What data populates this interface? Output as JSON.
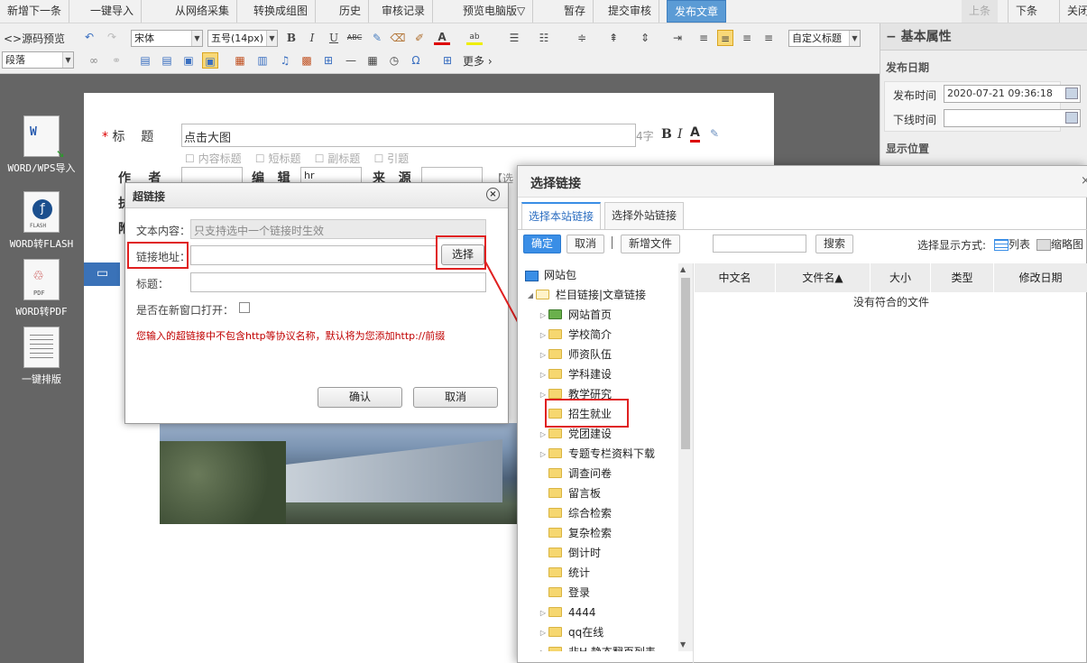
{
  "topbar": {
    "items": [
      "新增下一条",
      "一键导入",
      "从网络采集",
      "转换成组图",
      "历史",
      "审核记录",
      "预览电脑版▽",
      "暂存",
      "提交审核",
      "发布文章"
    ],
    "right_items": [
      "上条",
      "下条",
      "关闭"
    ]
  },
  "editor_toolbar": {
    "source": "<>源码",
    "preview": "预览",
    "font": "宋体",
    "size": "五号(14px)",
    "custom_title": "自定义标题",
    "paragraph": "段落",
    "more": "更多"
  },
  "right_panel": {
    "title": "基本属性",
    "publish_date_heading": "发布日期",
    "publish_time_label": "发布时间",
    "publish_time_value": "2020-07-21 09:36:18",
    "offline_time_label": "下线时间",
    "display_position": "显示位置"
  },
  "sidebar": {
    "items": [
      "WORD/WPS导入",
      "WORD转FLASH",
      "WORD转PDF",
      "一键排版"
    ]
  },
  "doc": {
    "title_label": "标",
    "title_label2": "题",
    "title_value": "点击大图",
    "char_count": "4字",
    "checks": [
      "内容标题",
      "短标题",
      "副标题",
      "引题"
    ],
    "author_label": "作",
    "author_label2": "者",
    "editor_label": "编",
    "editor_label2": "辑",
    "editor_value": "hr",
    "source_label": "来",
    "source_label2": "源",
    "side_text": "【选",
    "extra_labels": [
      "执",
      "附"
    ]
  },
  "hyperlink_dialog": {
    "title": "超链接",
    "text_label": "文本内容：",
    "text_placeholder": "只支持选中一个链接时生效",
    "url_label": "链接地址：",
    "select_btn": "选择",
    "title_field_label": "标题：",
    "new_window_label": "是否在新窗口打开：",
    "warning": "您输入的超链接中不包含http等协议名称，默认将为您添加http://前缀",
    "ok": "确认",
    "cancel": "取消"
  },
  "select_link_dialog": {
    "title": "选择链接",
    "tabs": [
      "选择本站链接",
      "选择外站链接"
    ],
    "btn_ok": "确定",
    "btn_cancel": "取消",
    "btn_new": "新增文件",
    "search_btn": "搜索",
    "display_mode": "选择显示方式:",
    "mode_list": "列表",
    "mode_thumb": "缩略图",
    "tree_root": "网站包",
    "tree_l1": "栏目链接|文章链接",
    "tree_items": [
      "网站首页",
      "学校简介",
      "师资队伍",
      "学科建设",
      "教学研究",
      "招生就业",
      "党团建设",
      "专题专栏资料下载",
      "调查问卷",
      "留言板",
      "综合检索",
      "复杂检索",
      "倒计时",
      "统计",
      "登录",
      "4444",
      "qq在线",
      "非H 静态翻页列表"
    ],
    "columns": [
      "中文名",
      "文件名▲",
      "大小",
      "类型",
      "修改日期"
    ],
    "empty": "没有符合的文件"
  },
  "colors": {
    "accent": "#5b9bd5",
    "highlight_red": "#e02020",
    "folder": "#f6d770",
    "warning": "#c00000"
  }
}
